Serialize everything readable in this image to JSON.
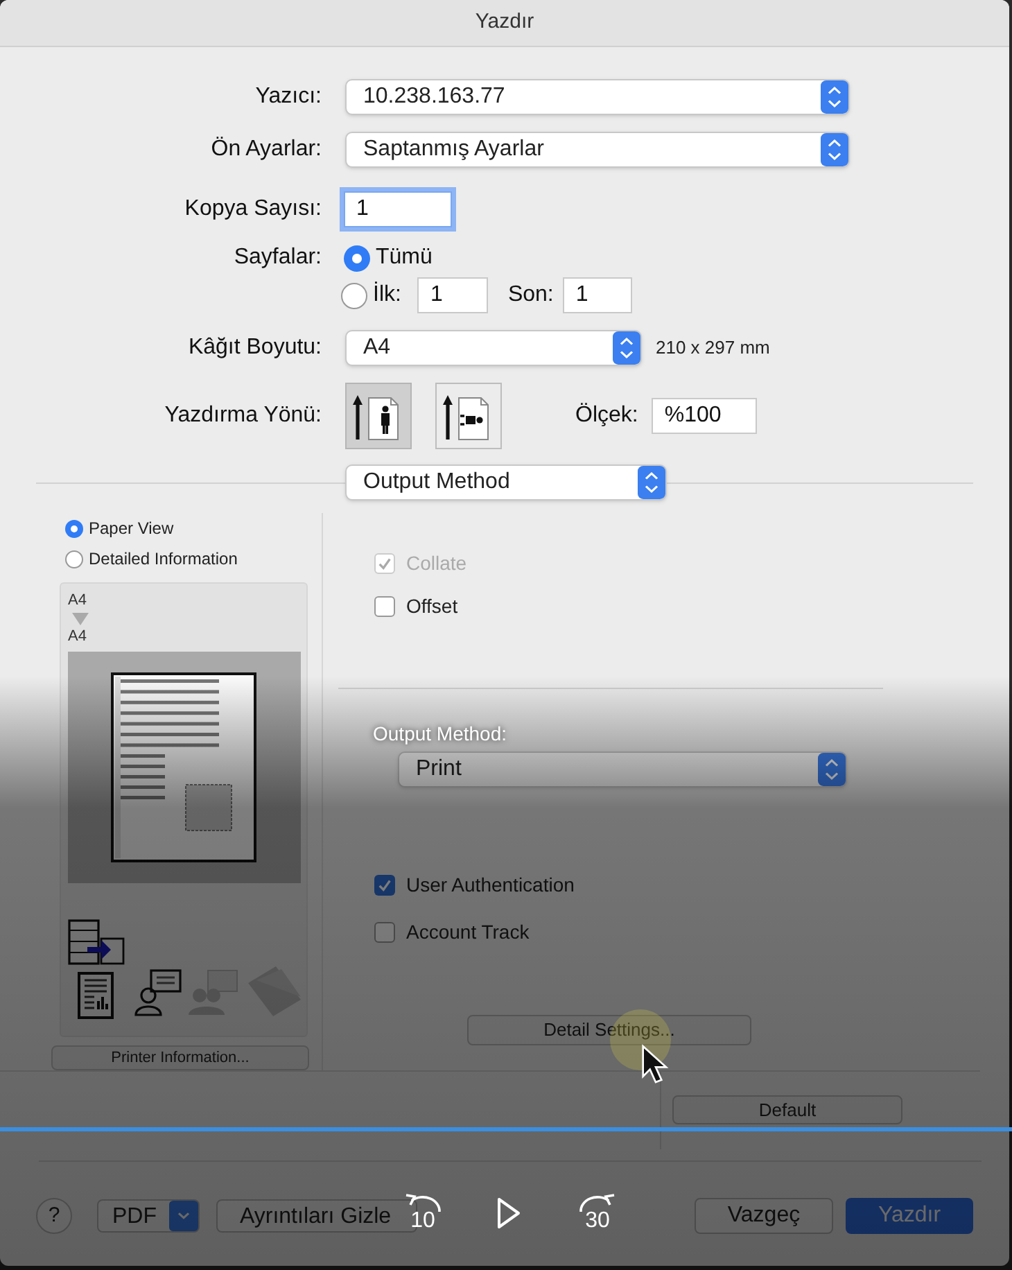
{
  "window": {
    "title": "Yazdır"
  },
  "form": {
    "printer": {
      "label": "Yazıcı:",
      "value": "10.238.163.77"
    },
    "presets": {
      "label": "Ön Ayarlar:",
      "value": "Saptanmış Ayarlar"
    },
    "copies": {
      "label": "Kopya Sayısı:",
      "value": "1",
      "focused": true
    },
    "pages": {
      "label": "Sayfalar:",
      "options": [
        {
          "label": "Tümü",
          "selected": true
        },
        {
          "label": "İlk:",
          "selected": false
        }
      ],
      "from": "1",
      "to_label": "Son:",
      "to": "1"
    },
    "paper_size": {
      "label": "Kâğıt Boyutu:",
      "value": "A4",
      "dimensions": "210 x 297 mm"
    },
    "orientation": {
      "label": "Yazdırma Yönü:",
      "options": [
        {
          "kind": "portrait",
          "selected": true
        },
        {
          "kind": "landscape",
          "selected": false
        }
      ]
    },
    "scale": {
      "label": "Ölçek:",
      "value": "%100"
    }
  },
  "panel_menu": {
    "value": "Output Method"
  },
  "preview": {
    "view_options": [
      {
        "label": "Paper View",
        "selected": true
      },
      {
        "label": "Detailed Information",
        "selected": false
      }
    ],
    "source_size": "A4",
    "output_size": "A4",
    "printer_info_button": "Printer Information..."
  },
  "options": {
    "checkboxes": [
      {
        "label": "Collate",
        "checked": true,
        "disabled": true
      },
      {
        "label": "Offset",
        "checked": false,
        "disabled": false
      }
    ],
    "output_method": {
      "label": "Output Method:",
      "value": "Print"
    },
    "auth": [
      {
        "label": "User Authentication",
        "checked": true,
        "disabled": false
      },
      {
        "label": "Account Track",
        "checked": false,
        "disabled": false
      }
    ],
    "detail_button": "Detail Settings...",
    "default_button": "Default"
  },
  "footer": {
    "help": "?",
    "pdf": "PDF",
    "hide_details": "Ayrıntıları Gizle",
    "cancel": "Vazgeç",
    "print": "Yazdır"
  },
  "video_controls": {
    "rewind": "10",
    "forward": "30"
  }
}
